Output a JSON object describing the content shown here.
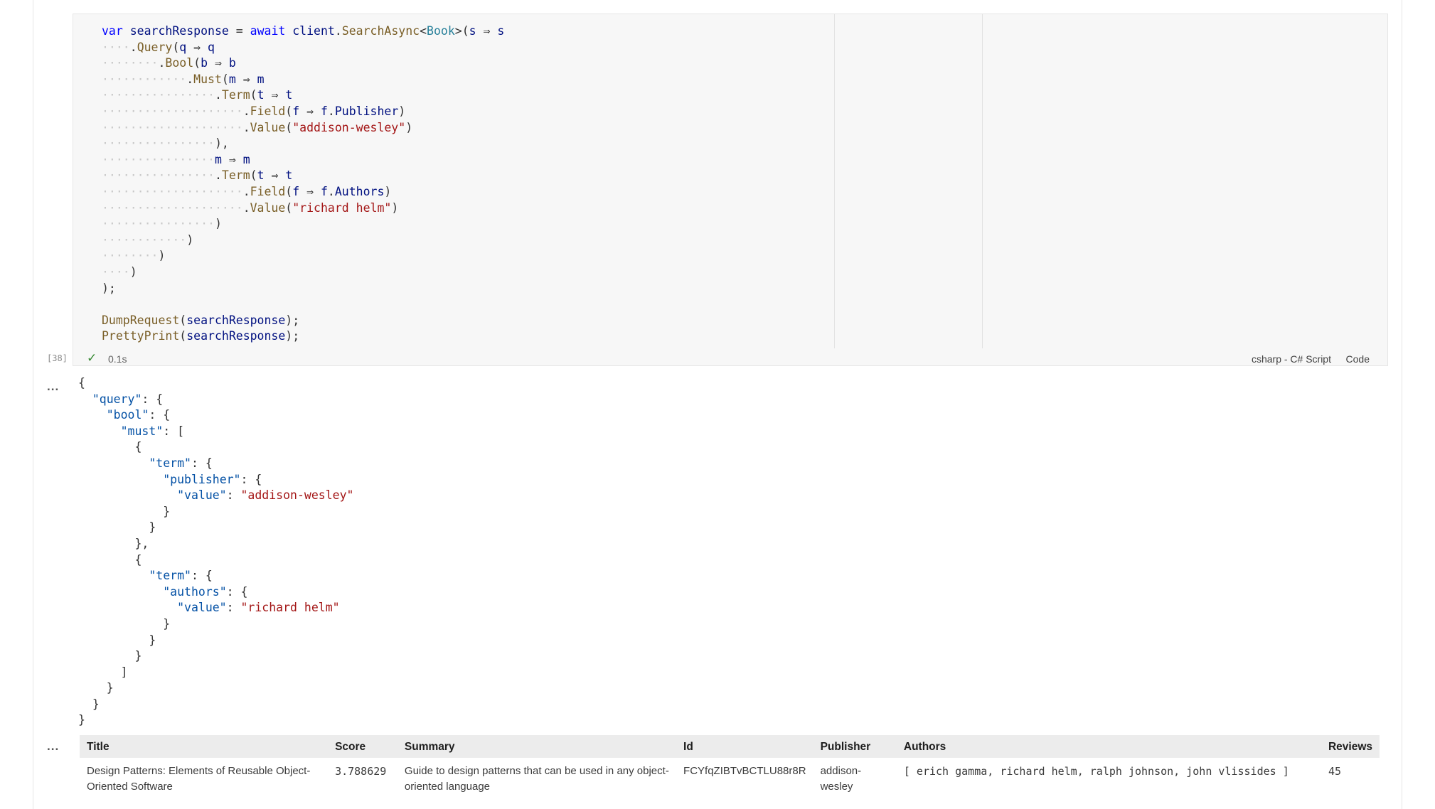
{
  "code_cell": {
    "lines": [
      [
        [
          "",
          "",
          "var",
          "kw"
        ],
        [
          " ",
          "ws"
        ],
        [
          "searchResponse",
          "id"
        ],
        [
          " ",
          "ws"
        ],
        [
          "=",
          "op"
        ],
        [
          " ",
          "ws"
        ],
        [
          "await",
          "kw"
        ],
        [
          " ",
          "ws"
        ],
        [
          "client",
          "id"
        ],
        [
          ".",
          "pu"
        ],
        [
          "SearchAsync",
          "fn"
        ],
        [
          "<",
          "pu"
        ],
        [
          "Book",
          "ty"
        ],
        [
          ">(",
          "pu"
        ],
        [
          "s",
          "id"
        ],
        [
          " ",
          "ws"
        ],
        [
          "⇒",
          "op"
        ],
        [
          " ",
          "ws"
        ],
        [
          "s",
          "id"
        ]
      ],
      [
        [
          "····",
          "ws"
        ],
        [
          ".",
          "pu"
        ],
        [
          "Query",
          "fn"
        ],
        [
          "(",
          "pu"
        ],
        [
          "q",
          "id"
        ],
        [
          " ",
          "ws"
        ],
        [
          "⇒",
          "op"
        ],
        [
          " ",
          "ws"
        ],
        [
          "q",
          "id"
        ]
      ],
      [
        [
          "········",
          "ws"
        ],
        [
          ".",
          "pu"
        ],
        [
          "Bool",
          "fn"
        ],
        [
          "(",
          "pu"
        ],
        [
          "b",
          "id"
        ],
        [
          " ",
          "ws"
        ],
        [
          "⇒",
          "op"
        ],
        [
          " ",
          "ws"
        ],
        [
          "b",
          "id"
        ]
      ],
      [
        [
          "············",
          "ws"
        ],
        [
          ".",
          "pu"
        ],
        [
          "Must",
          "fn"
        ],
        [
          "(",
          "pu"
        ],
        [
          "m",
          "id"
        ],
        [
          " ",
          "ws"
        ],
        [
          "⇒",
          "op"
        ],
        [
          " ",
          "ws"
        ],
        [
          "m",
          "id"
        ]
      ],
      [
        [
          "················",
          "ws"
        ],
        [
          ".",
          "pu"
        ],
        [
          "Term",
          "fn"
        ],
        [
          "(",
          "pu"
        ],
        [
          "t",
          "id"
        ],
        [
          " ",
          "ws"
        ],
        [
          "⇒",
          "op"
        ],
        [
          " ",
          "ws"
        ],
        [
          "t",
          "id"
        ]
      ],
      [
        [
          "····················",
          "ws"
        ],
        [
          ".",
          "pu"
        ],
        [
          "Field",
          "fn"
        ],
        [
          "(",
          "pu"
        ],
        [
          "f",
          "id"
        ],
        [
          " ",
          "ws"
        ],
        [
          "⇒",
          "op"
        ],
        [
          " ",
          "ws"
        ],
        [
          "f",
          "id"
        ],
        [
          ".",
          "pu"
        ],
        [
          "Publisher",
          "id"
        ],
        [
          ")",
          "pu"
        ]
      ],
      [
        [
          "····················",
          "ws"
        ],
        [
          ".",
          "pu"
        ],
        [
          "Value",
          "fn"
        ],
        [
          "(",
          "pu"
        ],
        [
          "\"addison-wesley\"",
          "st"
        ],
        [
          ")",
          "pu"
        ]
      ],
      [
        [
          "················",
          "ws"
        ],
        [
          "),",
          "pu"
        ]
      ],
      [
        [
          "················",
          "ws"
        ],
        [
          "m",
          "id"
        ],
        [
          " ",
          "ws"
        ],
        [
          "⇒",
          "op"
        ],
        [
          " ",
          "ws"
        ],
        [
          "m",
          "id"
        ]
      ],
      [
        [
          "················",
          "ws"
        ],
        [
          ".",
          "pu"
        ],
        [
          "Term",
          "fn"
        ],
        [
          "(",
          "pu"
        ],
        [
          "t",
          "id"
        ],
        [
          " ",
          "ws"
        ],
        [
          "⇒",
          "op"
        ],
        [
          " ",
          "ws"
        ],
        [
          "t",
          "id"
        ]
      ],
      [
        [
          "····················",
          "ws"
        ],
        [
          ".",
          "pu"
        ],
        [
          "Field",
          "fn"
        ],
        [
          "(",
          "pu"
        ],
        [
          "f",
          "id"
        ],
        [
          " ",
          "ws"
        ],
        [
          "⇒",
          "op"
        ],
        [
          " ",
          "ws"
        ],
        [
          "f",
          "id"
        ],
        [
          ".",
          "pu"
        ],
        [
          "Authors",
          "id"
        ],
        [
          ")",
          "pu"
        ]
      ],
      [
        [
          "····················",
          "ws"
        ],
        [
          ".",
          "pu"
        ],
        [
          "Value",
          "fn"
        ],
        [
          "(",
          "pu"
        ],
        [
          "\"richard helm\"",
          "st"
        ],
        [
          ")",
          "pu"
        ]
      ],
      [
        [
          "················",
          "ws"
        ],
        [
          ")",
          "pu"
        ]
      ],
      [
        [
          "············",
          "ws"
        ],
        [
          ")",
          "pu"
        ]
      ],
      [
        [
          "········",
          "ws"
        ],
        [
          ")",
          "pu"
        ]
      ],
      [
        [
          "····",
          "ws"
        ],
        [
          ")",
          "pu"
        ]
      ],
      [
        [
          ");",
          "pu"
        ]
      ],
      [],
      [
        [
          "DumpRequest",
          "fn"
        ],
        [
          "(",
          "pu"
        ],
        [
          "searchResponse",
          "id"
        ],
        [
          ");",
          "pu"
        ]
      ],
      [
        [
          "PrettyPrint",
          "fn"
        ],
        [
          "(",
          "pu"
        ],
        [
          "searchResponse",
          "id"
        ],
        [
          ");",
          "pu"
        ]
      ]
    ]
  },
  "cell_status": {
    "execution_count": "[38]",
    "duration": "0.1s",
    "kernel": "csharp - C# Script",
    "mode": "Code"
  },
  "output_more": "...",
  "json_output": [
    [
      [
        "{",
        "jp"
      ]
    ],
    [
      [
        "  ",
        "jp"
      ],
      [
        "\"query\"",
        "jk"
      ],
      [
        ": {",
        "jp"
      ]
    ],
    [
      [
        "    ",
        "jp"
      ],
      [
        "\"bool\"",
        "jk"
      ],
      [
        ": {",
        "jp"
      ]
    ],
    [
      [
        "      ",
        "jp"
      ],
      [
        "\"must\"",
        "jk"
      ],
      [
        ": [",
        "jp"
      ]
    ],
    [
      [
        "        {",
        "jp"
      ]
    ],
    [
      [
        "          ",
        "jp"
      ],
      [
        "\"term\"",
        "jk"
      ],
      [
        ": {",
        "jp"
      ]
    ],
    [
      [
        "            ",
        "jp"
      ],
      [
        "\"publisher\"",
        "jk"
      ],
      [
        ": {",
        "jp"
      ]
    ],
    [
      [
        "              ",
        "jp"
      ],
      [
        "\"value\"",
        "jk"
      ],
      [
        ": ",
        "jp"
      ],
      [
        "\"addison-wesley\"",
        "jv"
      ]
    ],
    [
      [
        "            }",
        "jp"
      ]
    ],
    [
      [
        "          }",
        "jp"
      ]
    ],
    [
      [
        "        },",
        "jp"
      ]
    ],
    [
      [
        "        {",
        "jp"
      ]
    ],
    [
      [
        "          ",
        "jp"
      ],
      [
        "\"term\"",
        "jk"
      ],
      [
        ": {",
        "jp"
      ]
    ],
    [
      [
        "            ",
        "jp"
      ],
      [
        "\"authors\"",
        "jk"
      ],
      [
        ": {",
        "jp"
      ]
    ],
    [
      [
        "              ",
        "jp"
      ],
      [
        "\"value\"",
        "jk"
      ],
      [
        ": ",
        "jp"
      ],
      [
        "\"richard helm\"",
        "jv"
      ]
    ],
    [
      [
        "            }",
        "jp"
      ]
    ],
    [
      [
        "          }",
        "jp"
      ]
    ],
    [
      [
        "        }",
        "jp"
      ]
    ],
    [
      [
        "      ]",
        "jp"
      ]
    ],
    [
      [
        "    }",
        "jp"
      ]
    ],
    [
      [
        "  }",
        "jp"
      ]
    ],
    [
      [
        "}",
        "jp"
      ]
    ]
  ],
  "table": {
    "headers": [
      "Title",
      "Score",
      "Summary",
      "Id",
      "Publisher",
      "Authors",
      "Reviews"
    ],
    "rows": [
      {
        "title": "Design Patterns: Elements of Reusable Object-Oriented Software",
        "score": "3.788629",
        "summary": "Guide to design patterns that can be used in any object-oriented language",
        "id": "FCYfqZIBTvBCTLU88r8R",
        "publisher": "addison-wesley",
        "authors": "[ erich gamma, richard helm, ralph johnson, john vlissides ]",
        "reviews": "45"
      }
    ]
  }
}
